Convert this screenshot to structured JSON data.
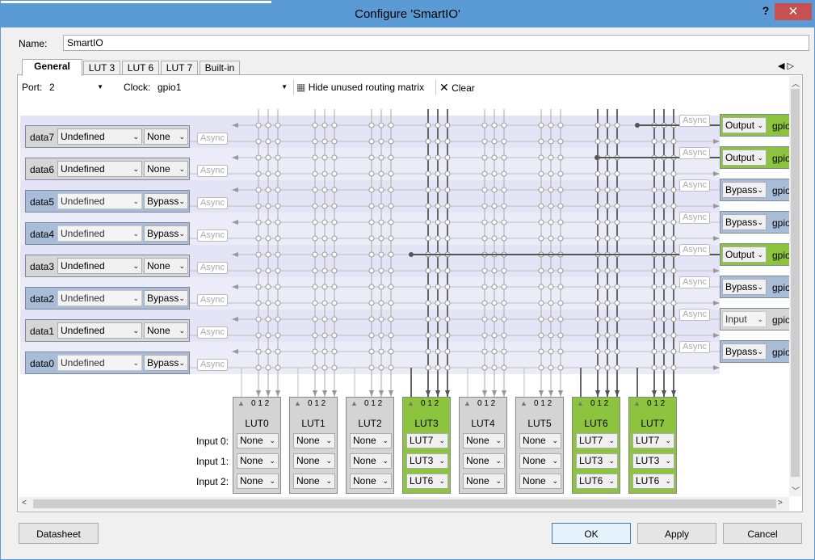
{
  "window": {
    "title": "Configure 'SmartIO'",
    "help": "?",
    "close": "✕"
  },
  "name": {
    "label": "Name:",
    "value": "SmartIO"
  },
  "tabs": [
    "General",
    "LUT 3",
    "LUT 6",
    "LUT 7",
    "Built-in"
  ],
  "toolbar": {
    "port_label": "Port:",
    "port_value": "2",
    "clock_label": "Clock:",
    "clock_value": "gpio1",
    "hide_label": "Hide unused routing matrix",
    "clear_label": "Clear"
  },
  "inputs": [
    {
      "name": "data7",
      "func": "Undefined",
      "sync": "None"
    },
    {
      "name": "data6",
      "func": "Undefined",
      "sync": "None"
    },
    {
      "name": "data5",
      "func": "Undefined",
      "sync": "Bypass"
    },
    {
      "name": "data4",
      "func": "Undefined",
      "sync": "Bypass"
    },
    {
      "name": "data3",
      "func": "Undefined",
      "sync": "None"
    },
    {
      "name": "data2",
      "func": "Undefined",
      "sync": "Bypass"
    },
    {
      "name": "data1",
      "func": "Undefined",
      "sync": "None"
    },
    {
      "name": "data0",
      "func": "Undefined",
      "sync": "Bypass"
    }
  ],
  "outputs": [
    {
      "mode": "Output",
      "pin": "gpio",
      "active": true
    },
    {
      "mode": "Output",
      "pin": "gpio",
      "active": true
    },
    {
      "mode": "Bypass",
      "pin": "gpio",
      "active": false
    },
    {
      "mode": "Bypass",
      "pin": "gpio",
      "active": false
    },
    {
      "mode": "Output",
      "pin": "gpio",
      "active": true
    },
    {
      "mode": "Bypass",
      "pin": "gpio",
      "active": false
    },
    {
      "mode": "Input",
      "pin": "gpio",
      "active": false
    },
    {
      "mode": "Bypass",
      "pin": "gpio",
      "active": false
    }
  ],
  "async_label": "Async",
  "lut_index_label": "0 1 2",
  "input_labels": [
    "Input 0:",
    "Input 1:",
    "Input 2:"
  ],
  "luts": [
    {
      "name": "LUT0",
      "in": [
        "None",
        "None",
        "None"
      ],
      "active": false
    },
    {
      "name": "LUT1",
      "in": [
        "None",
        "None",
        "None"
      ],
      "active": false
    },
    {
      "name": "LUT2",
      "in": [
        "None",
        "None",
        "None"
      ],
      "active": false
    },
    {
      "name": "LUT3",
      "in": [
        "LUT7",
        "LUT3",
        "LUT6"
      ],
      "active": true
    },
    {
      "name": "LUT4",
      "in": [
        "None",
        "None",
        "None"
      ],
      "active": false
    },
    {
      "name": "LUT5",
      "in": [
        "None",
        "None",
        "None"
      ],
      "active": false
    },
    {
      "name": "LUT6",
      "in": [
        "LUT7",
        "LUT3",
        "LUT6"
      ],
      "active": true
    },
    {
      "name": "LUT7",
      "in": [
        "LUT7",
        "LUT3",
        "LUT6"
      ],
      "active": true
    }
  ],
  "buttons": {
    "datasheet": "Datasheet",
    "ok": "OK",
    "apply": "Apply",
    "cancel": "Cancel"
  },
  "colors": {
    "title_bar": "#5b9bd5",
    "close": "#c75050",
    "lut_active": "#8dc43f",
    "lut_inactive": "#d4d4d4",
    "row_a": "#e4e4f6",
    "row_b": "#ececf9",
    "input_active": "#a9bdd8"
  }
}
